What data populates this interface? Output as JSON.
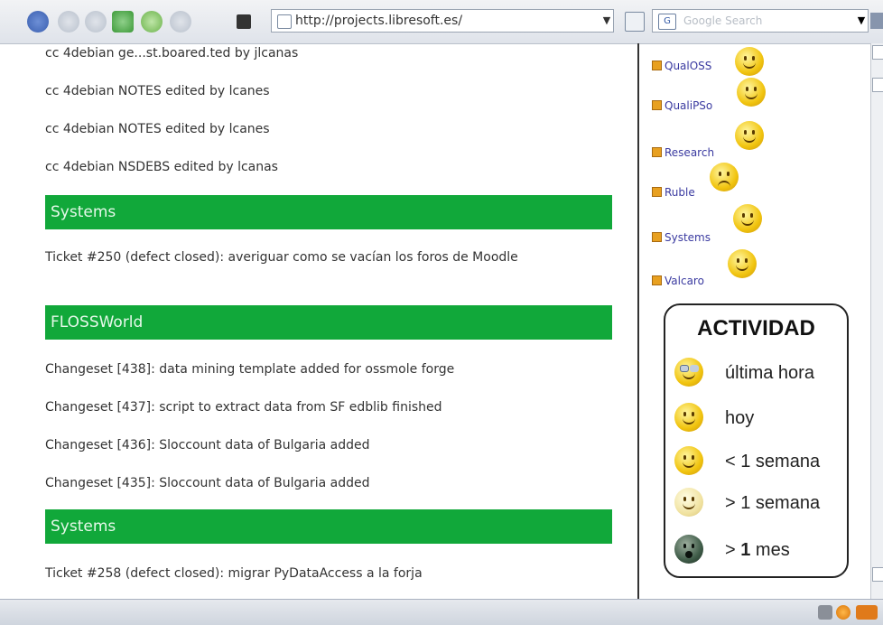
{
  "toolbar": {
    "url": "http://projects.libresoft.es/",
    "search_placeholder": "Google Search",
    "search_engine_icon": "google-icon",
    "icons": [
      "back-icon",
      "forward-icon",
      "reload-icon",
      "home-icon",
      "refresh-icon",
      "stop-icon",
      "bookmark-icon"
    ]
  },
  "main": {
    "entries_top": [
      "cc 4debian ge...st.boared.ted by jlcanas",
      "cc 4debian NOTES edited by lcanes",
      "cc 4debian NOTES edited by lcanes",
      "cc 4debian NSDEBS edited by lcanas"
    ],
    "sections": [
      {
        "title": "Systems",
        "items": [
          "Ticket #250 (defect closed): averiguar como se vacían los foros de Moodle"
        ]
      },
      {
        "title": "FLOSSWorld",
        "items": [
          "Changeset [438]: data mining template added for ossmole forge",
          "Changeset [437]: script to extract data from SF edblib finished",
          "Changeset [436]: Sloccount data of Bulgaria added",
          "Changeset [435]: Sloccount data of Bulgaria added"
        ]
      },
      {
        "title": "Systems",
        "items": [
          "Ticket #258 (defect closed): migrar PyDataAccess a la forja"
        ]
      }
    ]
  },
  "sidebar": {
    "projects": [
      {
        "name": "QualOSS",
        "mood": "happy"
      },
      {
        "name": "QualiPSo",
        "mood": "happy"
      },
      {
        "name": "Research",
        "mood": "happy"
      },
      {
        "name": "Ruble",
        "mood": "sad"
      },
      {
        "name": "Systems",
        "mood": "happy"
      },
      {
        "name": "Valcaro",
        "mood": "happy"
      }
    ],
    "activity": {
      "title": "ACTIVIDAD",
      "legend": [
        {
          "icon": "sunglasses-smiley-icon",
          "label": "última hora"
        },
        {
          "icon": "happy-smiley-icon",
          "label": "hoy"
        },
        {
          "icon": "neutral-smiley-icon",
          "label": "< 1 semana"
        },
        {
          "icon": "pale-smiley-icon",
          "label": "> 1 semana"
        },
        {
          "icon": "dead-smiley-icon",
          "label_prefix": "> ",
          "label_bold": "1",
          "label_suffix": " mes"
        }
      ]
    }
  }
}
